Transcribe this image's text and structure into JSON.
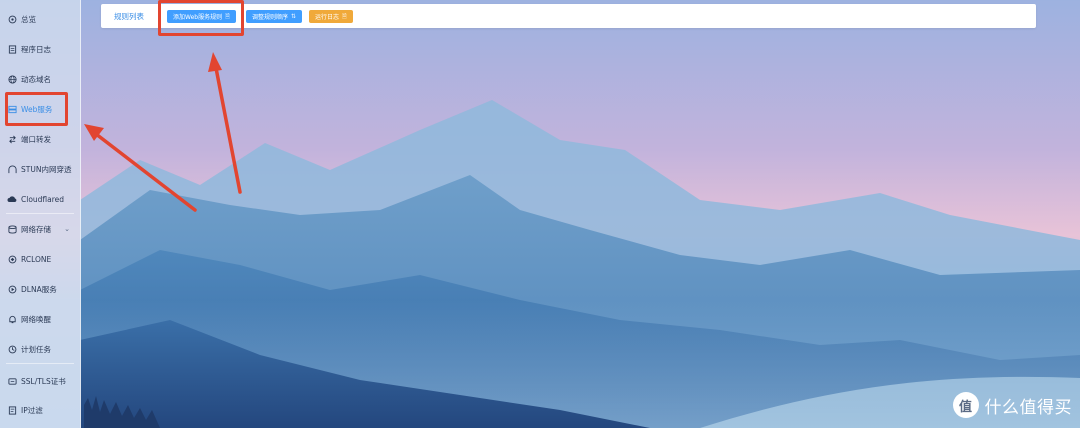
{
  "sidebar": {
    "items": [
      {
        "label": "总览",
        "icon": "home-icon"
      },
      {
        "label": "程序日志",
        "icon": "document-icon"
      },
      {
        "label": "动态域名",
        "icon": "globe-icon"
      },
      {
        "label": "Web服务",
        "icon": "server-icon",
        "active": true
      },
      {
        "label": "端口转发",
        "icon": "port-forward-icon"
      },
      {
        "label": "STUN内网穿透",
        "icon": "tunnel-icon"
      },
      {
        "label": "Cloudflared",
        "icon": "cloud-icon"
      },
      {
        "label": "网络存储",
        "icon": "storage-icon",
        "expandable": true
      },
      {
        "label": "RCLONE",
        "icon": "sync-icon"
      },
      {
        "label": "DLNA服务",
        "icon": "media-icon"
      },
      {
        "label": "网络唤醒",
        "icon": "bell-icon"
      },
      {
        "label": "计划任务",
        "icon": "clock-icon"
      },
      {
        "label": "SSL/TLS证书",
        "icon": "certificate-icon"
      },
      {
        "label": "IP过滤",
        "icon": "filter-icon"
      }
    ]
  },
  "topbar": {
    "title": "规则列表",
    "buttons": [
      {
        "label": "添加Web服务规则",
        "icon": "add-doc-icon"
      },
      {
        "label": "调整规则顺序",
        "icon": "sort-icon"
      },
      {
        "label": "运行日志",
        "icon": "log-icon"
      }
    ]
  },
  "colors": {
    "accent": "#409eff",
    "orange": "#f0a93a",
    "annotation_red": "#e24530"
  },
  "watermark": {
    "logo_glyph": "值",
    "text": "什么值得买"
  }
}
